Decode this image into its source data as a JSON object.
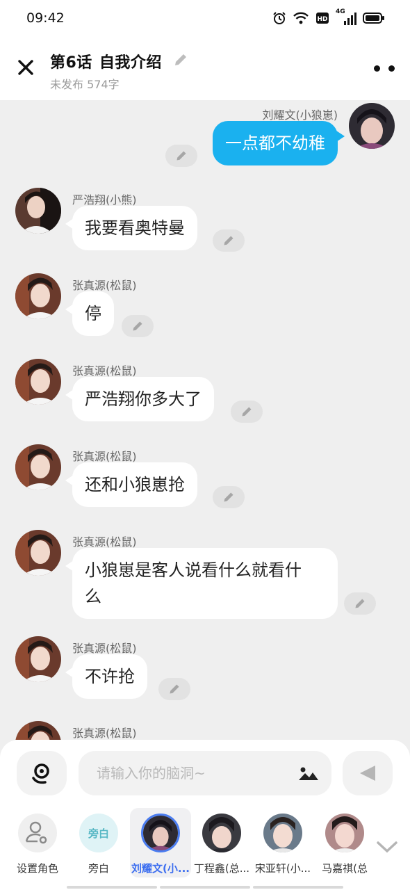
{
  "status_bar": {
    "time": "09:42",
    "icons": [
      "alarm-icon",
      "wifi-icon",
      "hd-icon",
      "signal-4g-icon",
      "battery-icon"
    ],
    "network_label": "4G"
  },
  "header": {
    "episode": "第6话",
    "title": "自我介绍",
    "subtitle": "未发布 574字"
  },
  "messages": [
    {
      "side": "right",
      "speaker": "刘耀文(小狼崽)",
      "text": "一点都不幼稚"
    },
    {
      "side": "left",
      "speaker": "严浩翔(小熊)",
      "text": "我要看奥特曼"
    },
    {
      "side": "left",
      "speaker": "张真源(松鼠)",
      "text": "停"
    },
    {
      "side": "left",
      "speaker": "张真源(松鼠)",
      "text": "严浩翔你多大了"
    },
    {
      "side": "left",
      "speaker": "张真源(松鼠)",
      "text": "还和小狼崽抢"
    },
    {
      "side": "left",
      "speaker": "张真源(松鼠)",
      "line1": "小狼崽是客人说看什么就看什",
      "line2": "么"
    },
    {
      "side": "left",
      "speaker": "张真源(松鼠)",
      "text": "不许抢"
    },
    {
      "side": "left",
      "speaker": "张真源(松鼠)",
      "text": ""
    }
  ],
  "composer": {
    "placeholder": "请输入你的脑洞~"
  },
  "roles": [
    {
      "label": "设置角色",
      "kind": "settings"
    },
    {
      "label": "旁白",
      "badge": "旁白",
      "kind": "narrator"
    },
    {
      "label": "刘耀文(小...",
      "kind": "character",
      "selected": true
    },
    {
      "label": "丁程鑫(总...",
      "kind": "character"
    },
    {
      "label": "宋亚轩(小...",
      "kind": "character"
    },
    {
      "label": "马嘉祺(总",
      "kind": "character"
    }
  ],
  "colors": {
    "accent": "#1ab1ef",
    "selected_role": "#3c6ef0",
    "chat_background": "#efefef",
    "edit_pill": "#e2e2e2"
  }
}
